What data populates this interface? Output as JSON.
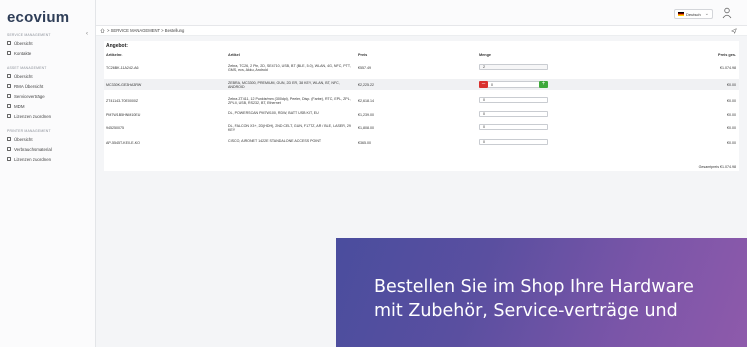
{
  "app": {
    "logo": "ecovium"
  },
  "sidebar": {
    "collapse_icon": "chevron-left-icon",
    "sections": [
      {
        "title": "SERVICE MANAGEMENT",
        "items": [
          {
            "label": "Übersicht"
          },
          {
            "label": "Kontakte"
          }
        ]
      },
      {
        "title": "ASSET MANAGEMENT",
        "items": [
          {
            "label": "Übersicht"
          },
          {
            "label": "RMA Übersicht"
          },
          {
            "label": "Serviceverträge"
          },
          {
            "label": "MDM"
          },
          {
            "label": "Lizenzen zuordnen"
          }
        ]
      },
      {
        "title": "PRINTER MANAGEMENT",
        "items": [
          {
            "label": "Übersicht"
          },
          {
            "label": "Verbrauchsmaterial"
          },
          {
            "label": "Lizenzen zuordnen"
          }
        ]
      }
    ]
  },
  "topbar": {
    "language": "Deutsch",
    "user_icon": "user-icon"
  },
  "breadcrumb": {
    "path": "> SERVICE MANAGEMENT > Bestellung"
  },
  "order": {
    "title": "Angebot:",
    "columns": {
      "code": "Artikelnr.",
      "article": "Artikel",
      "price": "Preis",
      "qty": "Menge",
      "total": "Preis ges."
    },
    "rows": [
      {
        "code": "TC26BK-11A242-A6",
        "article": "Zebra, TC26, 2 Pin, 2D, SE4710, USB, BT (BLE, 5.0), WLAN, 4G, NFC, PTT, GMS, ecs, Akku, Android",
        "price": "€557.49",
        "qty": "2",
        "total": "€1.074.98"
      },
      {
        "code": "MC330K-GE3HA3RW",
        "article": "ZEBRA, MC3300, PREMIUM, GUN, 2D ER, 38 KEY, WLAN, BT, NFC, ANDROID",
        "price": "€2,225.22",
        "qty": "0",
        "total": "€0.00"
      },
      {
        "code": "ZT41143-T0E0000Z",
        "article": "Zebra ZT411, 12 Punkte/mm (300dpi), Peeler, Disp. (Farbe), RTC, EPL, ZPL, ZPLII, USB, RS232, BT, Ethernet",
        "price": "€2,618.14",
        "qty": "0",
        "total": "€0.00"
      },
      {
        "code": "PM7W1B5HNM10EU",
        "article": "DL, POWERSCAN PM7W100, RDW, BATT USB KIT, EU",
        "price": "€1,239.00",
        "qty": "0",
        "total": "€0.00"
      },
      {
        "code": "945250075",
        "article": "DL, FALCON X3+, 2D(HDH), 2ND CELT, GUN, F17TZ, AR / BLE, LASER, 29 KEY",
        "price": "€1,808.00",
        "qty": "0",
        "total": "€0.00"
      },
      {
        "code": "AP-5545T-KE0-E-KO",
        "article": "CISCO, AIRONET 1422E STANDALONE ACCESS POINT",
        "price": "€365.00",
        "qty": "0",
        "total": "€0.00"
      }
    ],
    "grand_total": "Gesamtpreis €1.074.98"
  },
  "promo": {
    "text": "Bestellen Sie im Shop Ihre Hardware mit Zubehör, Service-verträge und"
  },
  "colors": {
    "minus": "#d9312f",
    "plus": "#3ea83c",
    "promo_start": "#4a4d9e",
    "promo_end": "#8e5aab",
    "logo": "#2f3e58"
  }
}
